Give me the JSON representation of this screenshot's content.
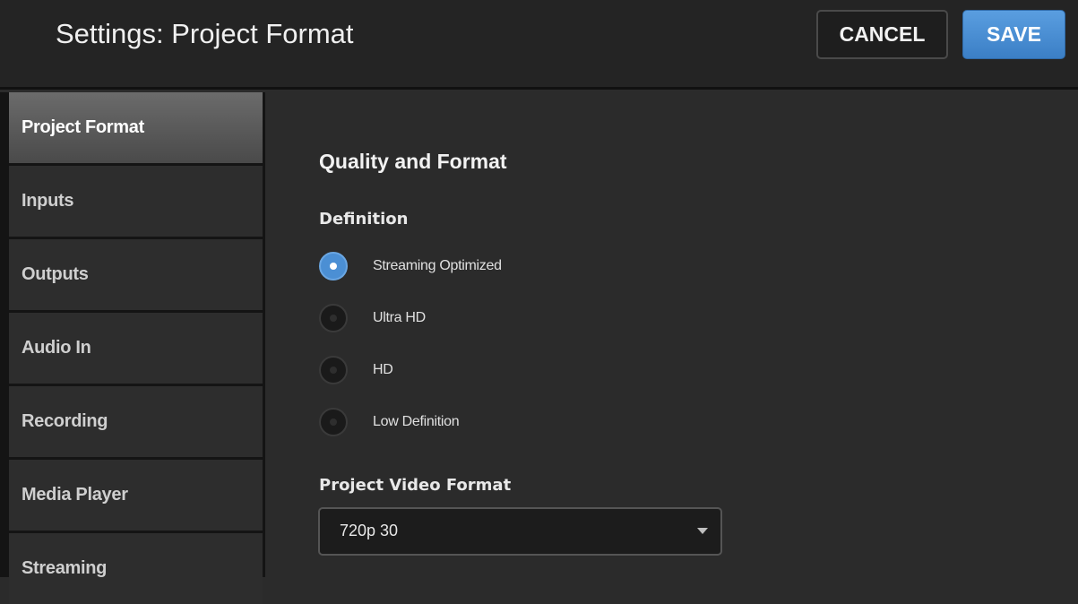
{
  "header": {
    "title": "Settings: Project Format",
    "cancel_label": "CANCEL",
    "save_label": "SAVE"
  },
  "sidebar": {
    "items": [
      {
        "label": "Project Format",
        "active": true
      },
      {
        "label": "Inputs",
        "active": false
      },
      {
        "label": "Outputs",
        "active": false
      },
      {
        "label": "Audio In",
        "active": false
      },
      {
        "label": "Recording",
        "active": false
      },
      {
        "label": "Media Player",
        "active": false
      },
      {
        "label": "Streaming",
        "active": false
      }
    ]
  },
  "main": {
    "section_title": "Quality and Format",
    "definition": {
      "label": "Definition",
      "options": [
        {
          "label": "Streaming Optimized",
          "selected": true
        },
        {
          "label": "Ultra HD",
          "selected": false
        },
        {
          "label": "HD",
          "selected": false
        },
        {
          "label": "Low Definition",
          "selected": false
        }
      ]
    },
    "video_format": {
      "label": "Project Video Format",
      "value": "720p 30"
    }
  },
  "colors": {
    "accent": "#4b8fd4",
    "background": "#2b2b2b",
    "sidebar_active": "#5a5a5a"
  }
}
